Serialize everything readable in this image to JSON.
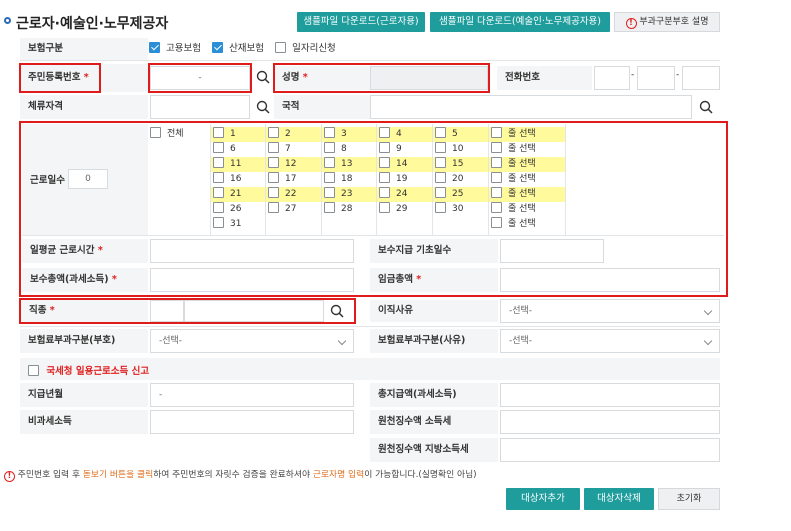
{
  "header": {
    "title": "근로자·예술인·노무제공자",
    "btn_sample_worker": "샘플파일 다운로드(근로자용)",
    "btn_sample_artist": "샘플파일 다운로드(예술인·노무제공자용)",
    "btn_code_help": "부과구분부호 설명"
  },
  "insurance": {
    "label": "보험구분",
    "employment": "고용보험",
    "industrial": "산재보험",
    "daily": "일자리신청"
  },
  "fields": {
    "resident_no_label": "주민등록번호",
    "resident_no_value": "-",
    "name_label": "성명",
    "phone_label": "전화번호",
    "phone_sep1": "-",
    "phone_sep2": "-",
    "residence_label": "체류자격",
    "nationality_label": "국적",
    "workdays_label": "근로일수",
    "workdays_value": "0",
    "all_label": "전체",
    "avg_hours_label": "일평균 근로시간",
    "pay_basis_days_label": "보수지급 기초일수",
    "total_pay_label": "보수총액(과세소득)",
    "total_wage_label": "임금총액",
    "job_label": "직종",
    "leave_reason_label": "이직사유",
    "leave_reason_value": "-선택-",
    "premium_code_label": "보험료부과구분(부호)",
    "premium_code_value": "-선택-",
    "premium_reason_label": "보험료부과구분(사유)",
    "premium_reason_value": "-선택-",
    "nts_report_label": "국세청 일용근로소득 신고",
    "pay_month_label": "지급년월",
    "pay_month_value": "-",
    "total_income_label": "총지급액(과세소득)",
    "nontax_label": "비과세소득",
    "withhold_income_label": "원천징수액 소득세",
    "withhold_local_label": "원천징수액 지방소득세"
  },
  "days": {
    "rows": [
      [
        "1",
        "2",
        "3",
        "4",
        "5"
      ],
      [
        "6",
        "7",
        "8",
        "9",
        "10"
      ],
      [
        "11",
        "12",
        "13",
        "14",
        "15"
      ],
      [
        "16",
        "17",
        "18",
        "19",
        "20"
      ],
      [
        "21",
        "22",
        "23",
        "24",
        "25"
      ],
      [
        "26",
        "27",
        "28",
        "29",
        "30"
      ],
      [
        "31"
      ]
    ],
    "row_select_label": "줄 선택"
  },
  "notice": {
    "p1": "주민번호 입력 후 ",
    "p2": "돋보기 버튼을 클릭",
    "p3": "하여 주민번호의 자릿수 검증을 완료하셔야 ",
    "p4": "근로자명 입력",
    "p5": "이 가능합니다.(실명확인 아님)"
  },
  "actions": {
    "add": "대상자추가",
    "delete": "대상자삭제",
    "reset": "초기화"
  },
  "colors": {
    "teal": "#1f9c9c",
    "red": "#e01b1b",
    "yellow": "#fffa9c",
    "check_blue": "#2a8fd6"
  }
}
